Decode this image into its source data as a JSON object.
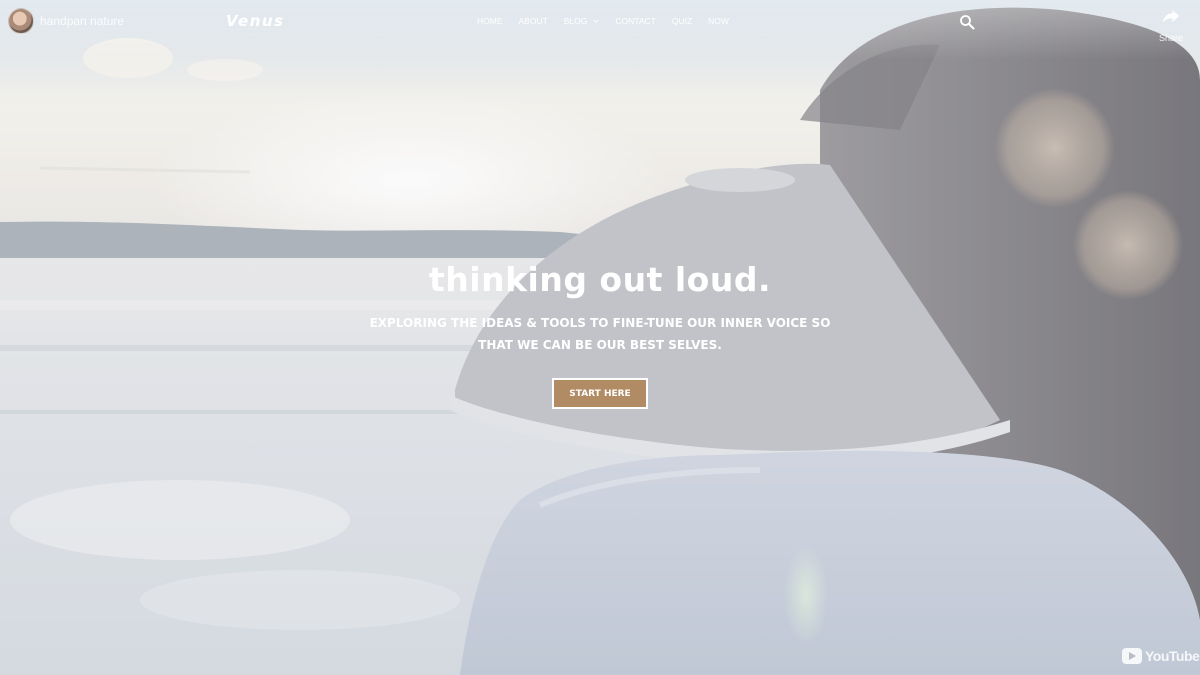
{
  "youtube": {
    "channel_name": "handpan nature",
    "share_label": "Share",
    "logo_text": "YouTube",
    "avatar_icon": "channel-avatar",
    "share_icon": "share-arrow-icon"
  },
  "site": {
    "brand": "Venus",
    "nav": [
      {
        "label": "HOME"
      },
      {
        "label": "ABOUT"
      },
      {
        "label": "BLOG",
        "has_dropdown": true
      },
      {
        "label": "CONTACT"
      },
      {
        "label": "QUIZ"
      },
      {
        "label": "NOW"
      }
    ],
    "search_icon": "search-icon"
  },
  "hero": {
    "title": "thinking out loud.",
    "subtitle": "EXPLORING THE IDEAS & TOOLS TO FINE-TUNE OUR INNER VOICE SO THAT WE CAN BE OUR BEST SELVES.",
    "cta_label": "START HERE"
  },
  "colors": {
    "cta_background": "#b18b64",
    "text": "#ffffff"
  }
}
